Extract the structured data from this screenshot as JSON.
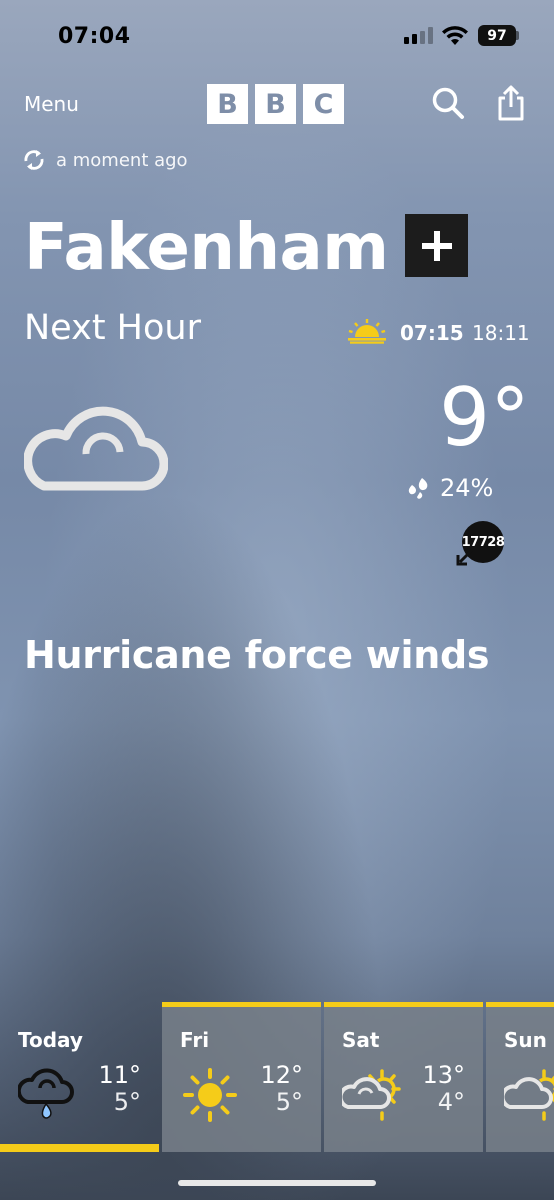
{
  "status_bar": {
    "time": "07:04",
    "battery": "97"
  },
  "header": {
    "menu_label": "Menu",
    "logo_letters": [
      "B",
      "B",
      "C"
    ],
    "search_icon": "search-icon",
    "share_icon": "share-icon"
  },
  "updated": {
    "text": "a moment ago",
    "icon": "refresh-icon"
  },
  "location": {
    "name": "Fakenham",
    "add_icon": "plus-icon"
  },
  "current": {
    "period_label": "Next Hour",
    "sunrise": "07:15",
    "sunset": "18:11",
    "temperature": "9°",
    "precipitation": "24%",
    "wind_speed": "17728",
    "summary": "Hurricane force winds",
    "condition_icon": "cloud-icon"
  },
  "forecast": [
    {
      "day": "Today",
      "high": "11°",
      "low": "5°",
      "icon": "cloud-rain-icon",
      "selected": true
    },
    {
      "day": "Fri",
      "high": "12°",
      "low": "5°",
      "icon": "sun-icon",
      "selected": false
    },
    {
      "day": "Sat",
      "high": "13°",
      "low": "4°",
      "icon": "sun-cloud-icon",
      "selected": false
    },
    {
      "day": "Sun",
      "high": "",
      "low": "",
      "icon": "sun-cloud-icon",
      "selected": false
    }
  ],
  "colors": {
    "accent": "#f5cc19",
    "sky_top": "#9aa7bd",
    "sky_bottom": "#3c4655"
  }
}
